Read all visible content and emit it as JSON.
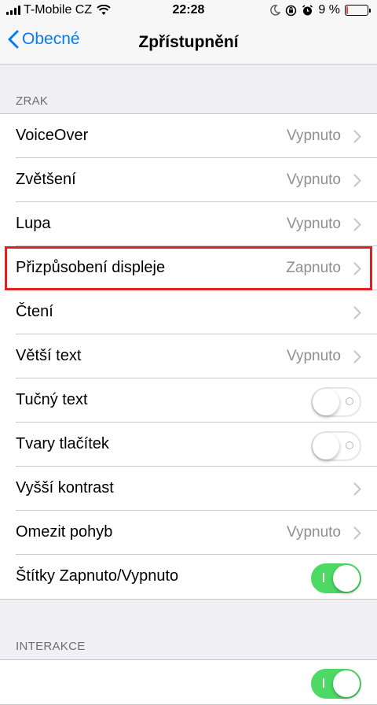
{
  "status": {
    "carrier": "T-Mobile CZ",
    "time": "22:28",
    "battery": "9 %",
    "battery_level": 0.09,
    "battery_color": "#ff3b30",
    "icons": [
      "signal-icon",
      "wifi-icon",
      "moon-icon",
      "rotation-lock-icon",
      "alarm-icon",
      "battery-icon"
    ]
  },
  "nav": {
    "back_label": "Obecné",
    "title": "Zpřístupnění",
    "accent": "#007aff"
  },
  "sections": [
    {
      "header": "ZRAK",
      "rows": [
        {
          "label": "VoiceOver",
          "value": "Vypnuto",
          "type": "disclosure"
        },
        {
          "label": "Zvětšení",
          "value": "Vypnuto",
          "type": "disclosure"
        },
        {
          "label": "Lupa",
          "value": "Vypnuto",
          "type": "disclosure"
        },
        {
          "label": "Přizpůsobení displeje",
          "value": "Zapnuto",
          "type": "disclosure",
          "highlighted": true
        },
        {
          "label": "Čtení",
          "value": "",
          "type": "disclosure"
        },
        {
          "label": "Větší text",
          "value": "Vypnuto",
          "type": "disclosure"
        },
        {
          "label": "Tučný text",
          "type": "toggle",
          "on": false
        },
        {
          "label": "Tvary tlačítek",
          "type": "toggle",
          "on": false
        },
        {
          "label": "Vyšší kontrast",
          "value": "",
          "type": "disclosure"
        },
        {
          "label": "Omezit pohyb",
          "value": "Vypnuto",
          "type": "disclosure"
        },
        {
          "label": "Štítky Zapnuto/Vypnuto",
          "type": "toggle",
          "on": true
        }
      ]
    },
    {
      "header": "INTERAKCE",
      "rows": [
        {
          "label": "",
          "type": "toggle",
          "on": true
        }
      ]
    }
  ],
  "colors": {
    "toggle_on": "#4cd964",
    "highlight_border": "#e02020"
  }
}
